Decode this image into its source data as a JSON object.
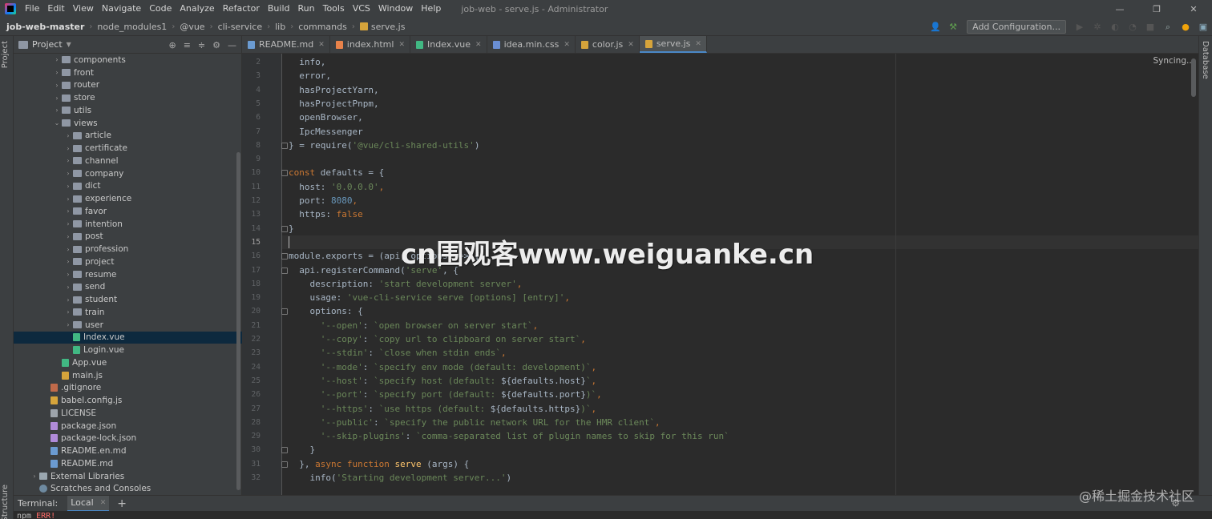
{
  "menubar": {
    "items": [
      "File",
      "Edit",
      "View",
      "Navigate",
      "Code",
      "Analyze",
      "Refactor",
      "Build",
      "Run",
      "Tools",
      "VCS",
      "Window",
      "Help"
    ],
    "title": "job-web - serve.js - Administrator",
    "minimize": "—",
    "maximize": "❐",
    "close": "✕"
  },
  "navbar": {
    "crumbs": [
      "job-web-master",
      "node_modules1",
      "@vue",
      "cli-service",
      "lib",
      "commands",
      "serve.js"
    ],
    "add_config": "Add Configuration..."
  },
  "left_strip": {
    "project_tab": "Project",
    "structure_tab": "Structure"
  },
  "right_strip": {
    "database_tab": "Database"
  },
  "project": {
    "title": "Project",
    "tree": [
      {
        "label": "components",
        "indent": 3,
        "type": "folder",
        "chev": "›"
      },
      {
        "label": "front",
        "indent": 3,
        "type": "folder",
        "chev": "›"
      },
      {
        "label": "router",
        "indent": 3,
        "type": "folder",
        "chev": "›"
      },
      {
        "label": "store",
        "indent": 3,
        "type": "folder",
        "chev": "›"
      },
      {
        "label": "utils",
        "indent": 3,
        "type": "folder",
        "chev": "›"
      },
      {
        "label": "views",
        "indent": 3,
        "type": "folder",
        "chev": "⌄"
      },
      {
        "label": "article",
        "indent": 4,
        "type": "folder",
        "chev": "›"
      },
      {
        "label": "certificate",
        "indent": 4,
        "type": "folder",
        "chev": "›"
      },
      {
        "label": "channel",
        "indent": 4,
        "type": "folder",
        "chev": "›"
      },
      {
        "label": "company",
        "indent": 4,
        "type": "folder",
        "chev": "›"
      },
      {
        "label": "dict",
        "indent": 4,
        "type": "folder",
        "chev": "›"
      },
      {
        "label": "experience",
        "indent": 4,
        "type": "folder",
        "chev": "›"
      },
      {
        "label": "favor",
        "indent": 4,
        "type": "folder",
        "chev": "›"
      },
      {
        "label": "intention",
        "indent": 4,
        "type": "folder",
        "chev": "›"
      },
      {
        "label": "post",
        "indent": 4,
        "type": "folder",
        "chev": "›"
      },
      {
        "label": "profession",
        "indent": 4,
        "type": "folder",
        "chev": "›"
      },
      {
        "label": "project",
        "indent": 4,
        "type": "folder",
        "chev": "›"
      },
      {
        "label": "resume",
        "indent": 4,
        "type": "folder",
        "chev": "›"
      },
      {
        "label": "send",
        "indent": 4,
        "type": "folder",
        "chev": "›"
      },
      {
        "label": "student",
        "indent": 4,
        "type": "folder",
        "chev": "›"
      },
      {
        "label": "train",
        "indent": 4,
        "type": "folder",
        "chev": "›"
      },
      {
        "label": "user",
        "indent": 4,
        "type": "folder",
        "chev": "›"
      },
      {
        "label": "Index.vue",
        "indent": 4,
        "type": "vue",
        "chev": "",
        "selected": true
      },
      {
        "label": "Login.vue",
        "indent": 4,
        "type": "vue",
        "chev": ""
      },
      {
        "label": "App.vue",
        "indent": 3,
        "type": "vue",
        "chev": ""
      },
      {
        "label": "main.js",
        "indent": 3,
        "type": "js",
        "chev": ""
      },
      {
        "label": ".gitignore",
        "indent": 2,
        "type": "git",
        "chev": ""
      },
      {
        "label": "babel.config.js",
        "indent": 2,
        "type": "js",
        "chev": ""
      },
      {
        "label": "LICENSE",
        "indent": 2,
        "type": "txt",
        "chev": ""
      },
      {
        "label": "package.json",
        "indent": 2,
        "type": "json",
        "chev": ""
      },
      {
        "label": "package-lock.json",
        "indent": 2,
        "type": "json",
        "chev": ""
      },
      {
        "label": "README.en.md",
        "indent": 2,
        "type": "md",
        "chev": ""
      },
      {
        "label": "README.md",
        "indent": 2,
        "type": "md",
        "chev": ""
      },
      {
        "label": "External Libraries",
        "indent": 1,
        "type": "lib",
        "chev": "›"
      },
      {
        "label": "Scratches and Consoles",
        "indent": 1,
        "type": "scr",
        "chev": ""
      }
    ]
  },
  "editor": {
    "tabs": [
      {
        "label": "README.md",
        "color": "#6b9bd1",
        "active": false
      },
      {
        "label": "index.html",
        "color": "#e8824a",
        "active": false
      },
      {
        "label": "Index.vue",
        "color": "#41b883",
        "active": false
      },
      {
        "label": "idea.min.css",
        "color": "#6a8fd4",
        "active": false
      },
      {
        "label": "color.js",
        "color": "#d6a43b",
        "active": false
      },
      {
        "label": "serve.js",
        "color": "#d6a43b",
        "active": true
      }
    ],
    "syncing": "Syncing...",
    "current_line": 15,
    "lines": [
      {
        "n": "2",
        "t": [
          [
            "  info,",
            "#a9b7c6"
          ]
        ]
      },
      {
        "n": "3",
        "t": [
          [
            "  error,",
            "#a9b7c6"
          ]
        ]
      },
      {
        "n": "4",
        "t": [
          [
            "  hasProjectYarn,",
            "#a9b7c6"
          ]
        ]
      },
      {
        "n": "5",
        "t": [
          [
            "  hasProjectPnpm,",
            "#a9b7c6"
          ]
        ]
      },
      {
        "n": "6",
        "t": [
          [
            "  openBrowser,",
            "#a9b7c6"
          ]
        ]
      },
      {
        "n": "7",
        "t": [
          [
            "  IpcMessenger",
            "#a9b7c6"
          ]
        ]
      },
      {
        "n": "8",
        "t": [
          [
            "} = require(",
            "#a9b7c6"
          ],
          [
            "'@vue/cli-shared-utils'",
            "#6a8759"
          ],
          [
            ")",
            "#a9b7c6"
          ]
        ]
      },
      {
        "n": "9",
        "t": [
          [
            "",
            "#a9b7c6"
          ]
        ]
      },
      {
        "n": "10",
        "t": [
          [
            "const ",
            "#cc7832"
          ],
          [
            "defaults",
            "#a9b7c6"
          ],
          [
            " = {",
            "#a9b7c6"
          ]
        ]
      },
      {
        "n": "11",
        "t": [
          [
            "  host: ",
            "#a9b7c6"
          ],
          [
            "'0.0.0.0'",
            "#6a8759"
          ],
          [
            ",",
            "#cc7832"
          ]
        ]
      },
      {
        "n": "12",
        "t": [
          [
            "  port: ",
            "#a9b7c6"
          ],
          [
            "8080",
            "#6897bb"
          ],
          [
            ",",
            "#cc7832"
          ]
        ]
      },
      {
        "n": "13",
        "t": [
          [
            "  https: ",
            "#a9b7c6"
          ],
          [
            "false",
            "#cc7832"
          ]
        ]
      },
      {
        "n": "14",
        "t": [
          [
            "}",
            "#a9b7c6"
          ]
        ]
      },
      {
        "n": "15",
        "t": [
          [
            "",
            "#a9b7c6"
          ]
        ]
      },
      {
        "n": "16",
        "t": [
          [
            "module.exports = (api, options) => {",
            "#a9b7c6"
          ]
        ]
      },
      {
        "n": "17",
        "t": [
          [
            "  api.registerCommand(",
            "#a9b7c6"
          ],
          [
            "'serve'",
            "#6a8759"
          ],
          [
            ", {",
            "#a9b7c6"
          ]
        ]
      },
      {
        "n": "18",
        "t": [
          [
            "    description: ",
            "#a9b7c6"
          ],
          [
            "'start development server'",
            "#6a8759"
          ],
          [
            ",",
            "#cc7832"
          ]
        ]
      },
      {
        "n": "19",
        "t": [
          [
            "    usage: ",
            "#a9b7c6"
          ],
          [
            "'vue-cli-service serve [options] [entry]'",
            "#6a8759"
          ],
          [
            ",",
            "#cc7832"
          ]
        ]
      },
      {
        "n": "20",
        "t": [
          [
            "    options: {",
            "#a9b7c6"
          ]
        ]
      },
      {
        "n": "21",
        "t": [
          [
            "      ",
            "#a9b7c6"
          ],
          [
            "'--open'",
            "#6a8759"
          ],
          [
            ": ",
            "#a9b7c6"
          ],
          [
            "`open browser on server start`",
            "#6a8759"
          ],
          [
            ",",
            "#cc7832"
          ]
        ]
      },
      {
        "n": "22",
        "t": [
          [
            "      ",
            "#a9b7c6"
          ],
          [
            "'--copy'",
            "#6a8759"
          ],
          [
            ": ",
            "#a9b7c6"
          ],
          [
            "`copy url to clipboard on server start`",
            "#6a8759"
          ],
          [
            ",",
            "#cc7832"
          ]
        ]
      },
      {
        "n": "23",
        "t": [
          [
            "      ",
            "#a9b7c6"
          ],
          [
            "'--stdin'",
            "#6a8759"
          ],
          [
            ": ",
            "#a9b7c6"
          ],
          [
            "`close when stdin ends`",
            "#6a8759"
          ],
          [
            ",",
            "#cc7832"
          ]
        ]
      },
      {
        "n": "24",
        "t": [
          [
            "      ",
            "#a9b7c6"
          ],
          [
            "'--mode'",
            "#6a8759"
          ],
          [
            ": ",
            "#a9b7c6"
          ],
          [
            "`specify env mode (default: development)`",
            "#6a8759"
          ],
          [
            ",",
            "#cc7832"
          ]
        ]
      },
      {
        "n": "25",
        "t": [
          [
            "      ",
            "#a9b7c6"
          ],
          [
            "'--host'",
            "#6a8759"
          ],
          [
            ": ",
            "#a9b7c6"
          ],
          [
            "`specify host (default: ",
            "#6a8759"
          ],
          [
            "${defaults.host}",
            "#a9b7c6"
          ],
          [
            "`",
            "#6a8759"
          ],
          [
            ",",
            "#cc7832"
          ]
        ]
      },
      {
        "n": "26",
        "t": [
          [
            "      ",
            "#a9b7c6"
          ],
          [
            "'--port'",
            "#6a8759"
          ],
          [
            ": ",
            "#a9b7c6"
          ],
          [
            "`specify port (default: ",
            "#6a8759"
          ],
          [
            "${defaults.port}",
            "#a9b7c6"
          ],
          [
            ")`",
            "#6a8759"
          ],
          [
            ",",
            "#cc7832"
          ]
        ]
      },
      {
        "n": "27",
        "t": [
          [
            "      ",
            "#a9b7c6"
          ],
          [
            "'--https'",
            "#6a8759"
          ],
          [
            ": ",
            "#a9b7c6"
          ],
          [
            "`use https (default: ",
            "#6a8759"
          ],
          [
            "${defaults.https}",
            "#a9b7c6"
          ],
          [
            ")`",
            "#6a8759"
          ],
          [
            ",",
            "#cc7832"
          ]
        ]
      },
      {
        "n": "28",
        "t": [
          [
            "      ",
            "#a9b7c6"
          ],
          [
            "'--public'",
            "#6a8759"
          ],
          [
            ": ",
            "#a9b7c6"
          ],
          [
            "`specify the public network URL for the HMR client`",
            "#6a8759"
          ],
          [
            ",",
            "#cc7832"
          ]
        ]
      },
      {
        "n": "29",
        "t": [
          [
            "      ",
            "#a9b7c6"
          ],
          [
            "'--skip-plugins'",
            "#6a8759"
          ],
          [
            ": ",
            "#a9b7c6"
          ],
          [
            "`comma-separated list of plugin names to skip for this run`",
            "#6a8759"
          ]
        ]
      },
      {
        "n": "30",
        "t": [
          [
            "    }",
            "#a9b7c6"
          ]
        ]
      },
      {
        "n": "31",
        "t": [
          [
            "  }, ",
            "#a9b7c6"
          ],
          [
            "async function ",
            "#cc7832"
          ],
          [
            "serve",
            "#ffc66d"
          ],
          [
            " (args) {",
            "#a9b7c6"
          ]
        ]
      },
      {
        "n": "32",
        "t": [
          [
            "    info(",
            "#a9b7c6"
          ],
          [
            "'Starting development server...'",
            "#6a8759"
          ],
          [
            ")",
            "#a9b7c6"
          ]
        ]
      }
    ]
  },
  "terminal": {
    "label": "Terminal:",
    "tab": "Local",
    "plus": "+",
    "line_prefix": "npm ",
    "line_err": "ERR!"
  },
  "watermarks": {
    "center": "cn围观客www.weiguanke.cn",
    "corner": "@稀土掘金技术社区"
  },
  "colors": {
    "accent": "#4a88c7",
    "selection": "#0d293e",
    "keyword": "#cc7832",
    "string": "#6a8759",
    "number": "#6897bb"
  }
}
